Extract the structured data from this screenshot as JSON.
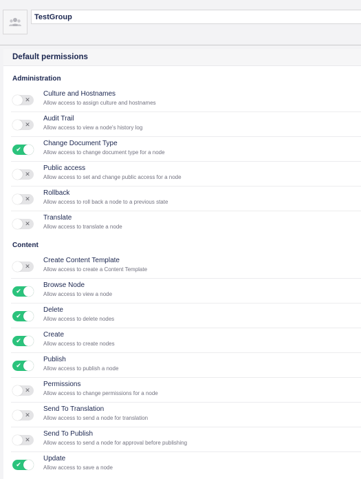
{
  "group": {
    "name": "TestGroup",
    "avatar_icon": "users-icon"
  },
  "panel": {
    "title": "Default permissions"
  },
  "sections": {
    "administration": {
      "title": "Administration",
      "items": [
        {
          "name": "Culture and Hostnames",
          "description": "Allow access to assign culture and hostnames",
          "enabled": false
        },
        {
          "name": "Audit Trail",
          "description": "Allow access to view a node's history log",
          "enabled": false
        },
        {
          "name": "Change Document Type",
          "description": "Allow access to change document type for a node",
          "enabled": true
        },
        {
          "name": "Public access",
          "description": "Allow access to set and change public access for a node",
          "enabled": false
        },
        {
          "name": "Rollback",
          "description": "Allow access to roll back a node to a previous state",
          "enabled": false
        },
        {
          "name": "Translate",
          "description": "Allow access to translate a node",
          "enabled": false
        }
      ]
    },
    "content": {
      "title": "Content",
      "items": [
        {
          "name": "Create Content Template",
          "description": "Allow access to create a Content Template",
          "enabled": false
        },
        {
          "name": "Browse Node",
          "description": "Allow access to view a node",
          "enabled": true
        },
        {
          "name": "Delete",
          "description": "Allow access to delete nodes",
          "enabled": true
        },
        {
          "name": "Create",
          "description": "Allow access to create nodes",
          "enabled": true
        },
        {
          "name": "Publish",
          "description": "Allow access to publish a node",
          "enabled": true
        },
        {
          "name": "Permissions",
          "description": "Allow access to change permissions for a node",
          "enabled": false
        },
        {
          "name": "Send To Translation",
          "description": "Allow access to send a node for translation",
          "enabled": false
        },
        {
          "name": "Send To Publish",
          "description": "Allow access to send a node for approval before publishing",
          "enabled": false
        },
        {
          "name": "Update",
          "description": "Allow access to save a node",
          "enabled": true
        }
      ]
    }
  },
  "toggle_glyphs": {
    "on": "✔",
    "off": "✕"
  },
  "colors": {
    "toggle_on": "#2bc37c",
    "toggle_off": "#e4e4e6",
    "text_primary": "#1b264f",
    "text_secondary": "#737380"
  }
}
